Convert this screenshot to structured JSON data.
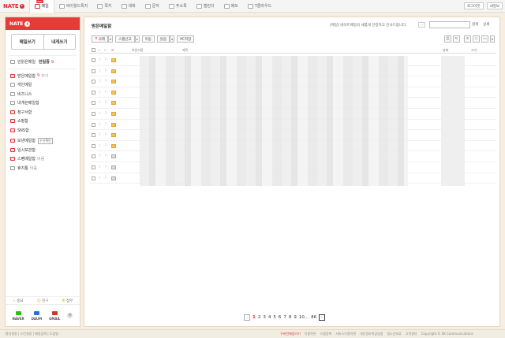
{
  "topbar": {
    "logo": "NATE",
    "items": [
      {
        "label": "메일",
        "badge": "NEW",
        "active": true
      },
      {
        "label": "싸이월드톡지",
        "active": false
      },
      {
        "label": "쪽지",
        "active": false
      },
      {
        "label": "대화",
        "active": false
      },
      {
        "label": "문자",
        "active": false
      },
      {
        "label": "주소록",
        "active": false
      },
      {
        "label": "캘린더",
        "active": false
      },
      {
        "label": "메모",
        "active": false
      },
      {
        "label": "T클라우드",
        "active": false
      }
    ],
    "login_button": "로그아웃",
    "myinfo_button": "내정보"
  },
  "sidebar": {
    "header": "NATE",
    "header_count": "5",
    "write_mail": "메일쓰기",
    "write_to_me": "내게쓰기",
    "unread": {
      "label": "안읽은메일",
      "value": "한일증",
      "count": "9"
    },
    "folders": [
      {
        "label": "받은메일함",
        "count": "9",
        "extra": "추가",
        "red": true
      },
      {
        "label": "개인메일",
        "red": false
      },
      {
        "label": "비즈니스",
        "red": false
      },
      {
        "label": "내게쓴메일함",
        "red": false
      },
      {
        "label": "청구서함",
        "red": true
      },
      {
        "label": "쇼핑함",
        "red": true
      },
      {
        "label": "SNS함",
        "red": true
      },
      {
        "label": "보낸메일함",
        "badge": "수신확인",
        "red": true
      },
      {
        "label": "임시보관함",
        "red": true
      },
      {
        "label": "스팸메일함",
        "extra": "비움",
        "red": true
      },
      {
        "label": "휴지통",
        "extra": "비움",
        "red": false
      }
    ],
    "bottom_links": [
      "중요",
      "친구",
      "첨부"
    ],
    "services": [
      {
        "label": "NAVER",
        "color": "#1ec800"
      },
      {
        "label": "DAUM",
        "color": "#2a6fd6"
      },
      {
        "label": "GMAIL",
        "color": "#d93025"
      }
    ]
  },
  "main": {
    "title": "받은메일함",
    "notice": "[메일] 네이트메일의 새롭게 단장하고 인사드립니다.",
    "search_button": "검색",
    "detail_button": "상세",
    "toolbar": {
      "delete": "삭제",
      "spam": "스팸신고",
      "move": "이동",
      "read": "읽음",
      "save_pc": "PC저장"
    },
    "columns": {
      "sender": "보낸사람",
      "subject": "제목",
      "date": "날짜",
      "size": "크기"
    },
    "rows": [
      {
        "unread": true
      },
      {
        "unread": true
      },
      {
        "unread": true
      },
      {
        "unread": true
      },
      {
        "unread": true
      },
      {
        "unread": true
      },
      {
        "unread": true
      },
      {
        "unread": true
      },
      {
        "unread": true
      },
      {
        "unread": false
      },
      {
        "unread": false
      },
      {
        "unread": false
      }
    ],
    "pager": {
      "pages": [
        "1",
        "2",
        "3",
        "4",
        "5",
        "6",
        "7",
        "8",
        "9",
        "10..."
      ],
      "last": "86",
      "current": "1"
    }
  },
  "footer": {
    "left": "환경설정 | 스킨설정 | 메일검색 | 도움말",
    "links": [
      "구버전메일가기",
      "이용약관",
      "스팸정책",
      "서비스이용약관",
      "개인정보취급방침",
      "청소년보호",
      "고객센터",
      "Copyright © SK Communications"
    ]
  }
}
